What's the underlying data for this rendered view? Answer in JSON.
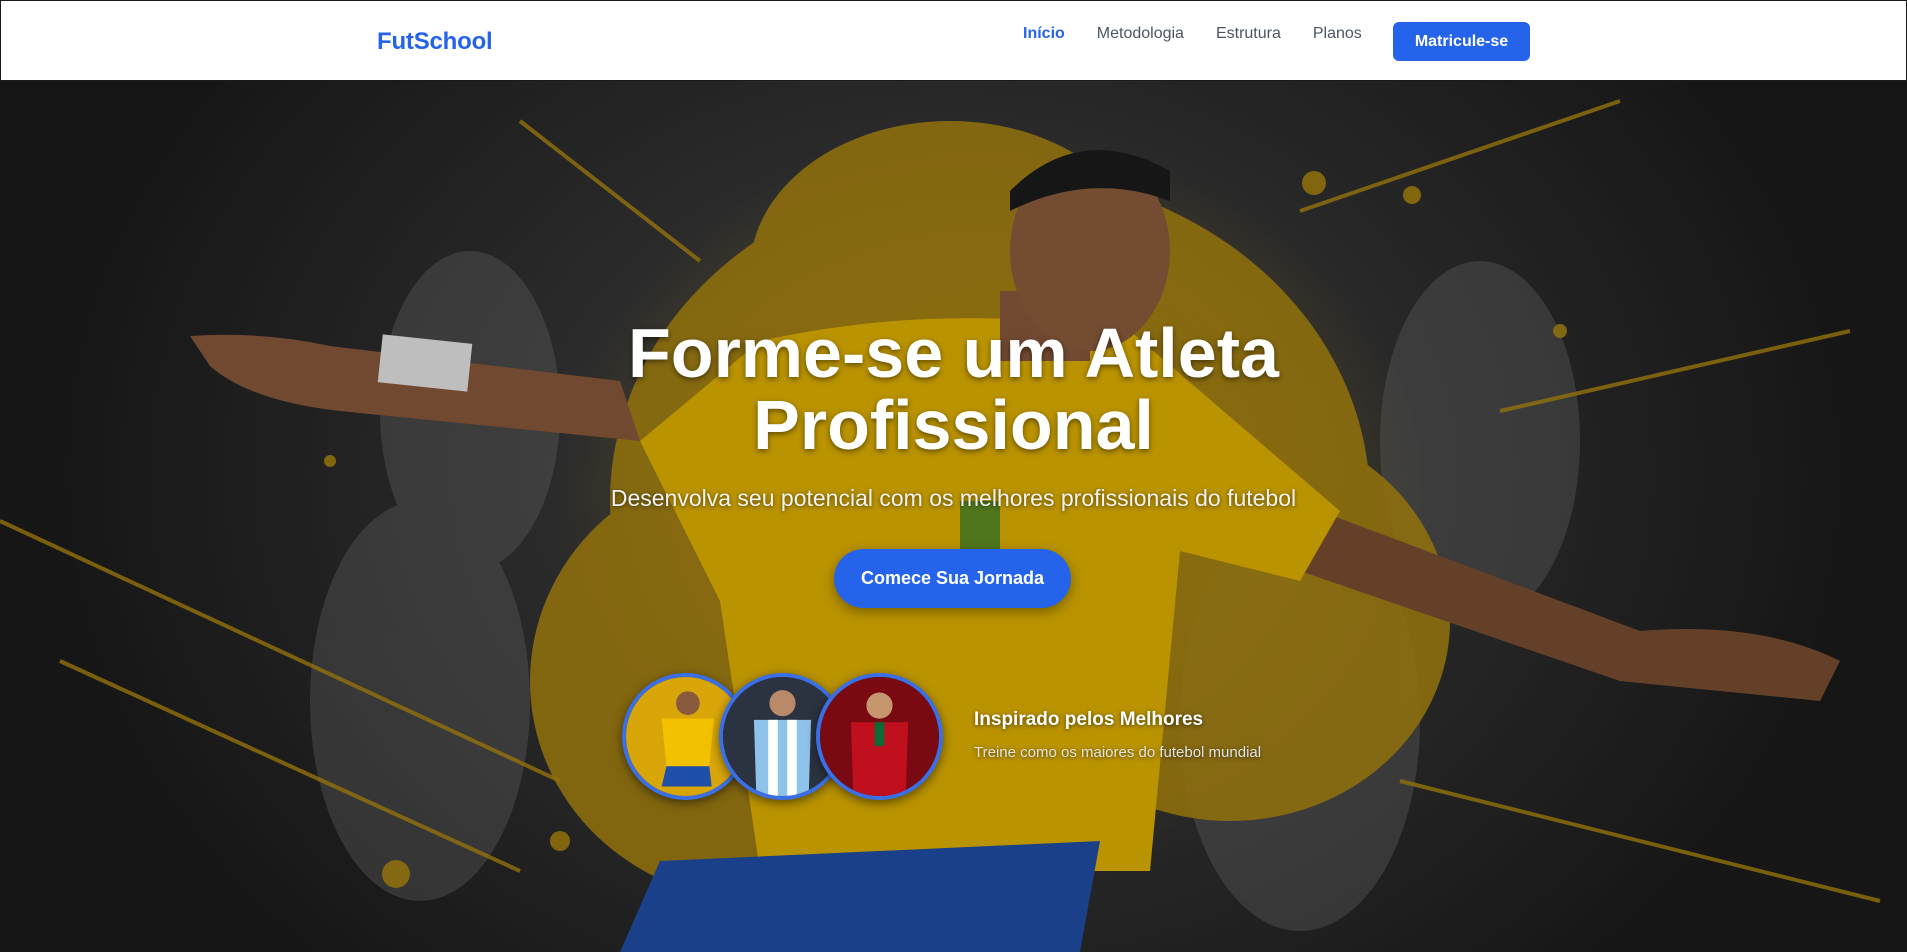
{
  "navbar": {
    "brand": "FutSchool",
    "links": [
      {
        "label": "Início",
        "active": true
      },
      {
        "label": "Metodologia",
        "active": false
      },
      {
        "label": "Estrutura",
        "active": false
      },
      {
        "label": "Planos",
        "active": false
      }
    ],
    "cta_label": "Matricule-se"
  },
  "hero": {
    "title_line1": "Forme-se um Atleta",
    "title_line2": "Profissional",
    "subtitle": "Desenvolva seu potencial com os melhores profissionais do futebol",
    "cta_label": "Comece Sua Jornada",
    "inspired": {
      "title": "Inspirado pelos Melhores",
      "subtitle": "Treine como os maiores do futebol mundial"
    },
    "avatars": [
      {
        "name": "player-yellow-kit-avatar",
        "kit_color": "#f2c200"
      },
      {
        "name": "player-striped-kit-avatar",
        "kit_color": "#8fc3ea"
      },
      {
        "name": "player-red-kit-avatar",
        "kit_color": "#c01020"
      }
    ]
  },
  "colors": {
    "accent": "#2563eb",
    "splash": "#b38b0f",
    "kit_yellow": "#f2c200"
  }
}
